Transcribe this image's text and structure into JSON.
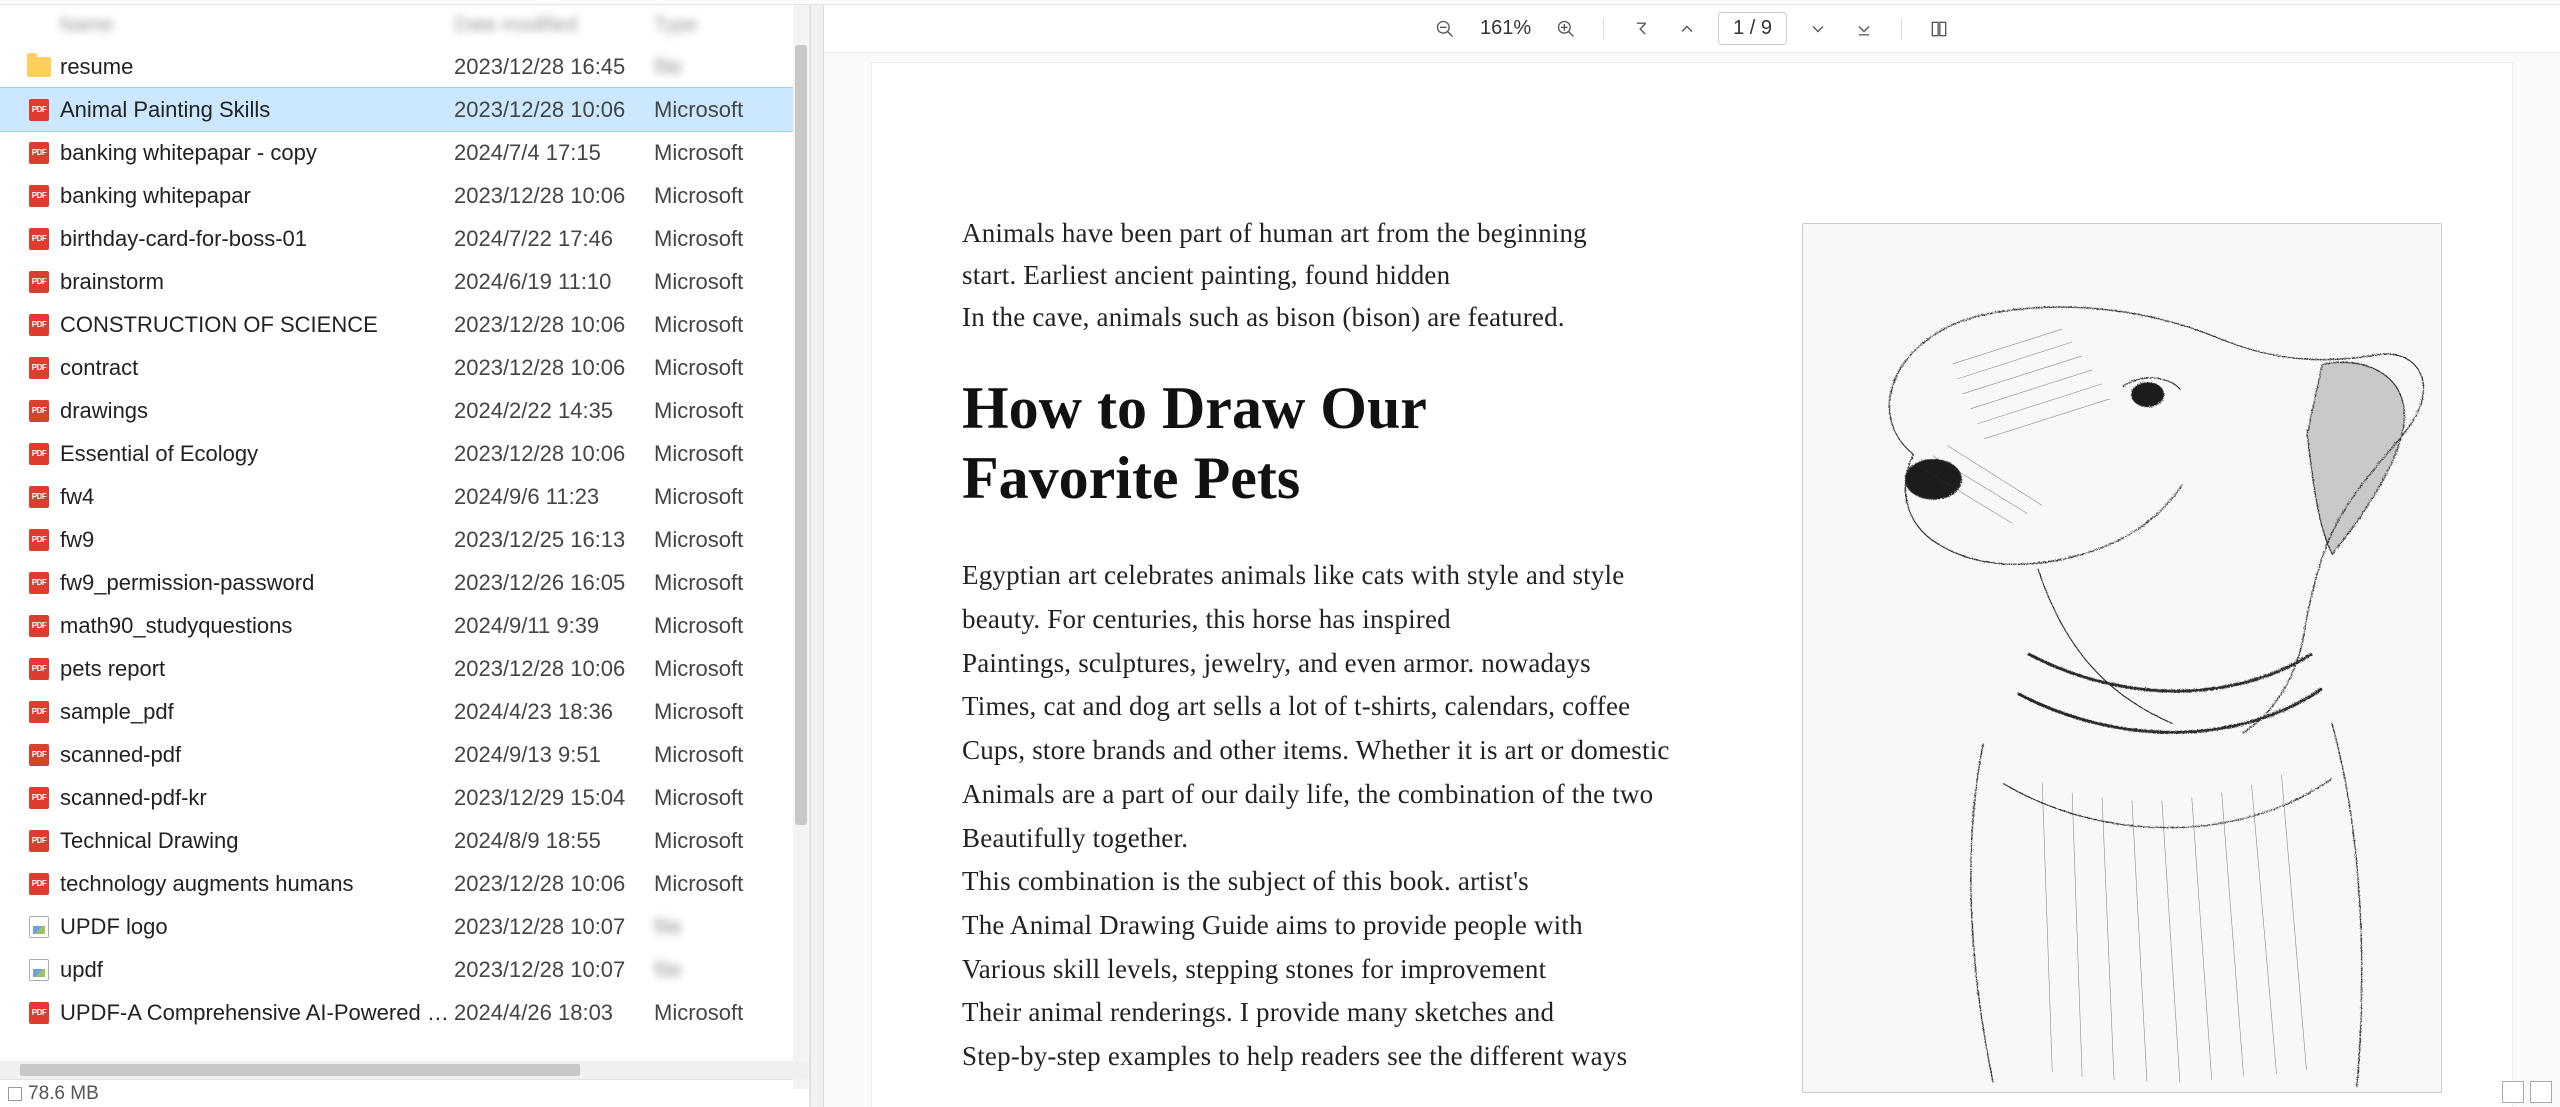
{
  "file_header": {
    "name_hdr": "Name",
    "date_hdr": "Date modified",
    "type_hdr": "Type"
  },
  "files": [
    {
      "icon": "folder",
      "name": "resume",
      "date": "2023/12/28 16:45",
      "type": "",
      "blurtype": true
    },
    {
      "icon": "pdf",
      "name": "Animal Painting Skills",
      "date": "2023/12/28 10:06",
      "type": "Microsoft",
      "selected": true
    },
    {
      "icon": "pdf",
      "name": "banking whitepapar - copy",
      "date": "2024/7/4 17:15",
      "type": "Microsoft"
    },
    {
      "icon": "pdf",
      "name": "banking whitepapar",
      "date": "2023/12/28 10:06",
      "type": "Microsoft"
    },
    {
      "icon": "pdf",
      "name": "birthday-card-for-boss-01",
      "date": "2024/7/22 17:46",
      "type": "Microsoft"
    },
    {
      "icon": "pdf",
      "name": "brainstorm",
      "date": "2024/6/19 11:10",
      "type": "Microsoft"
    },
    {
      "icon": "pdf",
      "name": "CONSTRUCTION OF SCIENCE",
      "date": "2023/12/28 10:06",
      "type": "Microsoft"
    },
    {
      "icon": "pdf",
      "name": "contract",
      "date": "2023/12/28 10:06",
      "type": "Microsoft"
    },
    {
      "icon": "pdf",
      "name": "drawings",
      "date": "2024/2/22 14:35",
      "type": "Microsoft"
    },
    {
      "icon": "pdf",
      "name": "Essential of Ecology",
      "date": "2023/12/28 10:06",
      "type": "Microsoft"
    },
    {
      "icon": "pdf",
      "name": "fw4",
      "date": "2024/9/6 11:23",
      "type": "Microsoft"
    },
    {
      "icon": "pdf",
      "name": "fw9",
      "date": "2023/12/25 16:13",
      "type": "Microsoft"
    },
    {
      "icon": "pdf",
      "name": "fw9_permission-password",
      "date": "2023/12/26 16:05",
      "type": "Microsoft"
    },
    {
      "icon": "pdf",
      "name": "math90_studyquestions",
      "date": "2024/9/11 9:39",
      "type": "Microsoft"
    },
    {
      "icon": "pdf",
      "name": "pets report",
      "date": "2023/12/28 10:06",
      "type": "Microsoft"
    },
    {
      "icon": "pdf",
      "name": "sample_pdf",
      "date": "2024/4/23 18:36",
      "type": "Microsoft"
    },
    {
      "icon": "pdf",
      "name": "scanned-pdf",
      "date": "2024/9/13 9:51",
      "type": "Microsoft"
    },
    {
      "icon": "pdf",
      "name": "scanned-pdf-kr",
      "date": "2023/12/29 15:04",
      "type": "Microsoft"
    },
    {
      "icon": "pdf",
      "name": "Technical Drawing",
      "date": "2024/8/9 18:55",
      "type": "Microsoft"
    },
    {
      "icon": "pdf",
      "name": "technology augments humans",
      "date": "2023/12/28 10:06",
      "type": "Microsoft"
    },
    {
      "icon": "img",
      "name": "UPDF logo",
      "date": "2023/12/28 10:07",
      "type": "",
      "blurtype": true
    },
    {
      "icon": "img",
      "name": "updf",
      "date": "2023/12/28 10:07",
      "type": "",
      "blurtype": true
    },
    {
      "icon": "pdf",
      "name": "UPDF-A Comprehensive AI-Powered PDF E...",
      "date": "2024/4/26 18:03",
      "type": "Microsoft"
    }
  ],
  "status": {
    "size": "78.6 MB"
  },
  "toolbar": {
    "zoom_pct": "161%",
    "page_current": "1",
    "page_sep": "/",
    "page_total": "9"
  },
  "document": {
    "intro_lines": [
      "Animals have been part of human art from the beginning",
      "start. Earliest ancient painting, found hidden",
      "In the cave, animals such as bison (bison) are featured."
    ],
    "title_line1": "How to Draw Our",
    "title_line2": "Favorite Pets",
    "body_lines": [
      "Egyptian art celebrates animals like cats with style and style",
      "beauty. For centuries, this horse has inspired",
      "Paintings, sculptures, jewelry, and even armor. nowadays",
      "Times, cat and dog art sells a lot of t-shirts, calendars, coffee",
      "Cups, store brands and other items. Whether it is art or domestic",
      "Animals are a part of our daily life, the combination of the two",
      "Beautifully together.",
      "This combination is the subject of this book. artist's",
      "The Animal Drawing Guide aims to provide people with",
      "Various skill levels, stepping stones for improvement",
      "Their animal renderings. I provide many sketches and",
      "Step-by-step examples to help readers see the different ways"
    ],
    "image_alt": "pencil sketch of a dog head and shoulders"
  }
}
